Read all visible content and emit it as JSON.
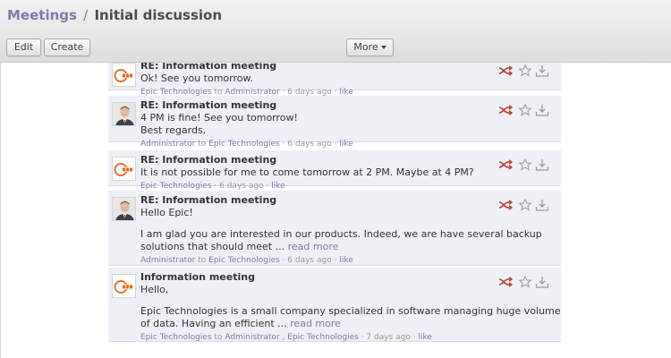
{
  "breadcrumb": {
    "parent": "Meetings",
    "separator": "/",
    "current": "Initial discussion"
  },
  "toolbar": {
    "edit_label": "Edit",
    "create_label": "Create",
    "more_label": "More"
  },
  "messages": [
    {
      "subject": "RE: Information meeting",
      "lines": [
        "Ok! See you tomorrow."
      ],
      "read_more": "",
      "author": "Epic Technologies",
      "to_word": "to",
      "recipients": [
        "Administrator"
      ],
      "time": "6 days ago",
      "like": "like",
      "avatar": "epic-logo"
    },
    {
      "subject": "RE: Information meeting",
      "lines": [
        "4 PM is fine! See you tomorrow!",
        "Best regards,"
      ],
      "read_more": "",
      "author": "Administrator",
      "to_word": "to",
      "recipients": [
        "Epic Technologies"
      ],
      "time": "6 days ago",
      "like": "like",
      "avatar": "person-photo"
    },
    {
      "subject": "RE: Information meeting",
      "lines": [
        "It is not possible for me to come tomorrow at 2 PM. Maybe at 4 PM?"
      ],
      "read_more": "",
      "author": "Epic Technologies",
      "to_word": "",
      "recipients": [],
      "time": "6 days ago",
      "like": "like",
      "avatar": "epic-logo"
    },
    {
      "subject": "RE: Information meeting",
      "lines": [
        "Hello Epic!",
        "",
        "I am glad you are interested in our products. Indeed, we are have several backup",
        "solutions that should meet ..."
      ],
      "read_more": "read more",
      "author": "Administrator",
      "to_word": "to",
      "recipients": [
        "Epic Technologies"
      ],
      "time": "6 days ago",
      "like": "like",
      "avatar": "person-photo"
    },
    {
      "subject": "Information meeting",
      "lines": [
        "Hello,",
        "",
        "Epic Technologies is a small company specialized in software managing huge volume",
        "of data. Having an efficient ..."
      ],
      "read_more": "read more",
      "author": "Epic Technologies",
      "to_word": "to",
      "recipients": [
        "Administrator",
        "Epic Technologies"
      ],
      "time": "7 days ago",
      "like": "like",
      "avatar": "epic-logo"
    }
  ],
  "colors": {
    "link": "#7c7bad",
    "message_bg": "#eef0f5",
    "reply_icon": "#c0392b",
    "meta_gray": "#999999"
  }
}
